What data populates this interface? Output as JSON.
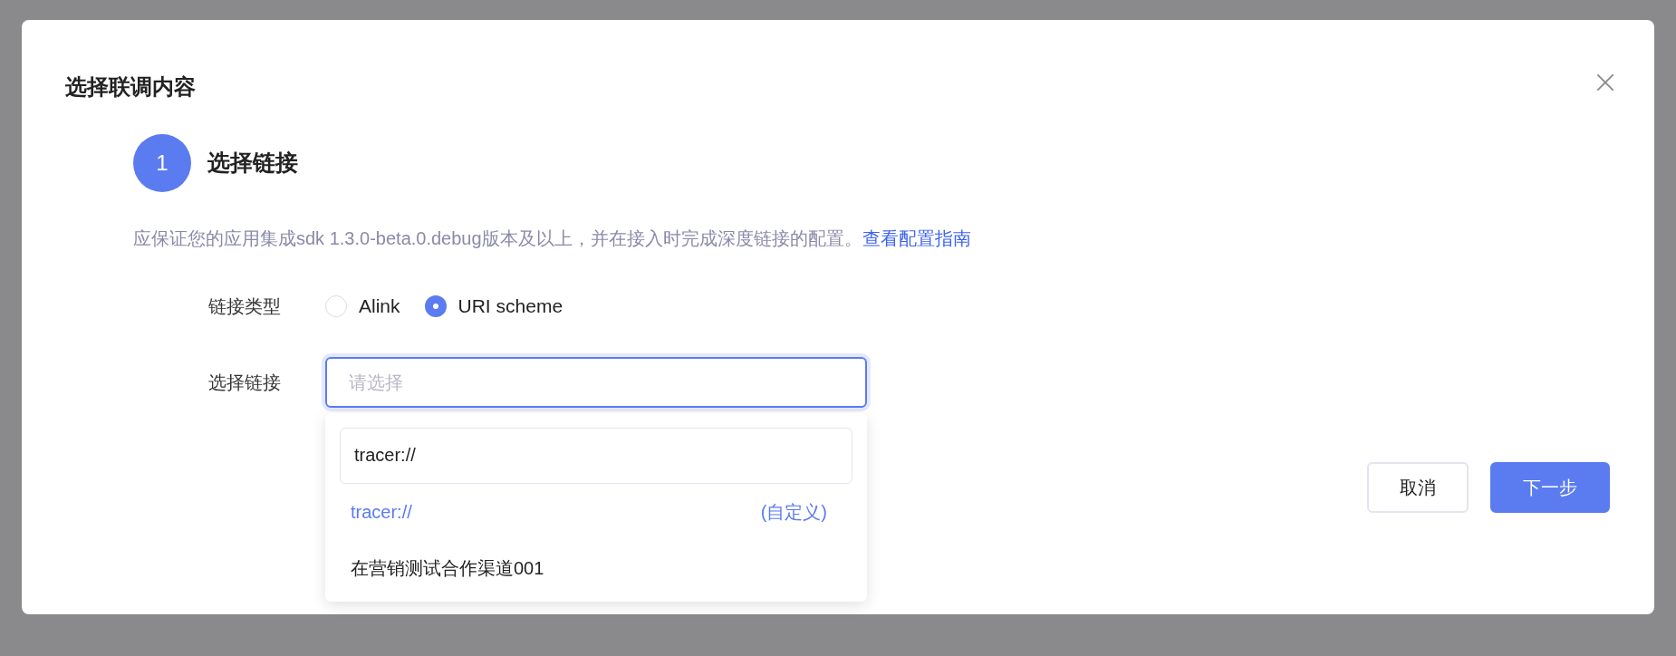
{
  "dialog": {
    "title": "选择联调内容",
    "step": {
      "number": "1",
      "title": "选择链接"
    },
    "description": {
      "text": "应保证您的应用集成sdk 1.3.0-beta.0.debug版本及以上，并在接入时完成深度链接的配置。",
      "link": "查看配置指南"
    },
    "link_type": {
      "label": "链接类型",
      "options": [
        {
          "label": "Alink",
          "selected": false
        },
        {
          "label": "URI scheme",
          "selected": true
        }
      ]
    },
    "link_select": {
      "label": "选择链接",
      "placeholder": "请选择",
      "focused": true,
      "dropdown": {
        "search_value": "tracer://",
        "options": [
          {
            "label": "tracer://",
            "tag": "(自定义)",
            "highlighted": true
          },
          {
            "label": "在营销测试合作渠道001",
            "highlighted": false
          }
        ]
      }
    },
    "buttons": [
      {
        "label": "取消",
        "kind": "secondary"
      },
      {
        "label": "下一步",
        "kind": "primary"
      }
    ]
  }
}
